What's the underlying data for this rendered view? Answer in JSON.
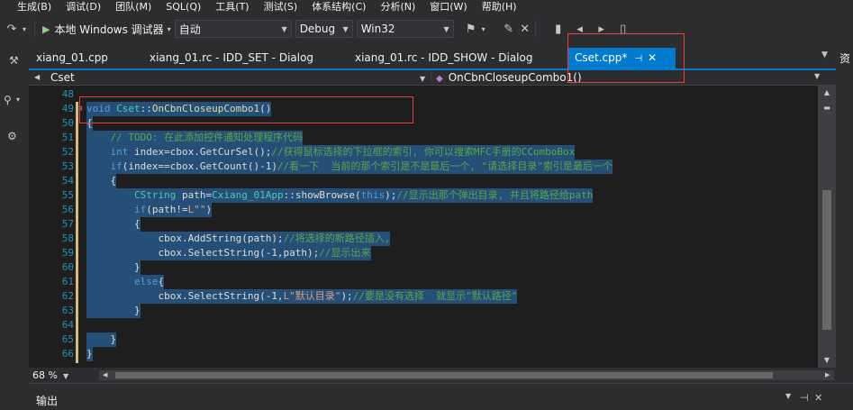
{
  "menu": [
    "生成(B)",
    "调试(D)",
    "团队(M)",
    "SQL(Q)",
    "工具(T)",
    "测试(S)",
    "体系结构(C)",
    "分析(N)",
    "窗口(W)",
    "帮助(H)"
  ],
  "toolbar": {
    "start_label": "本地 Windows 调试器",
    "config_auto": "自动",
    "config_build": "Debug",
    "config_platform": "Win32"
  },
  "tabs": [
    {
      "label": "xiang_01.cpp"
    },
    {
      "label": "xiang_01.rc - IDD_SET - Dialog"
    },
    {
      "label": "xiang_01.rc - IDD_SHOW - Dialog"
    }
  ],
  "active_tab": {
    "label": "Cset.cpp*"
  },
  "nav": {
    "class_scope": "Cset",
    "member": "OnCbnCloseupCombo1()"
  },
  "right_strip_label": "资",
  "line_numbers": [
    "48",
    "49",
    "50",
    "51",
    "52",
    "53",
    "54",
    "55",
    "56",
    "57",
    "58",
    "59",
    "60",
    "61",
    "62",
    "63",
    "64",
    "65",
    "66"
  ],
  "code": {
    "l49": {
      "kw": "void ",
      "cls": "Cset",
      "op": "::",
      "fn": "OnCbnCloseupCombo1",
      "rest": "()"
    },
    "l50": "{",
    "l51": "// TODO: 在此添加控件通知处理程序代码",
    "l52": {
      "kw": "int ",
      "text": "index=cbox.GetCurSel();",
      "cmt": "//获得鼠标选择的下拉框的索引, 你可以搜索MFC手册的CComboBox"
    },
    "l53": {
      "kw": "if",
      "text": "(index==cbox.GetCount()-1)",
      "cmt": "//看一下  当前的那个索引是不是最后一个, \"请选择目录\"索引是最后一个"
    },
    "l54": "{",
    "l55": {
      "cls": "CString ",
      "text": "path=",
      "cls2": "Cxiang_01App",
      "text2": "::showBrowse(",
      "kw": "this",
      "text3": ");",
      "cmt": "//显示出那个弹出目录, 并且将路径给path"
    },
    "l56": {
      "kw": "if",
      "text": "(path!=",
      "str": "L\"\"",
      "text2": ")"
    },
    "l57": "{",
    "l58": {
      "text": "cbox.AddString(path);",
      "cmt": "//将选择的新路径插入,"
    },
    "l59": {
      "text": "cbox.SelectString(-1,path);",
      "cmt": "//显示出来"
    },
    "l60": "}",
    "l61": {
      "kw": "else",
      "text": "{"
    },
    "l62": {
      "text": "cbox.SelectString(-1,",
      "str": "L\"默认目录\"",
      "text2": ");",
      "cmt": "//要是没有选择  就显示\"默认路径\""
    },
    "l63": "}",
    "l64": "",
    "l65": "}",
    "l66": "}"
  },
  "zoom": "68 %",
  "output": {
    "title": "输出"
  }
}
